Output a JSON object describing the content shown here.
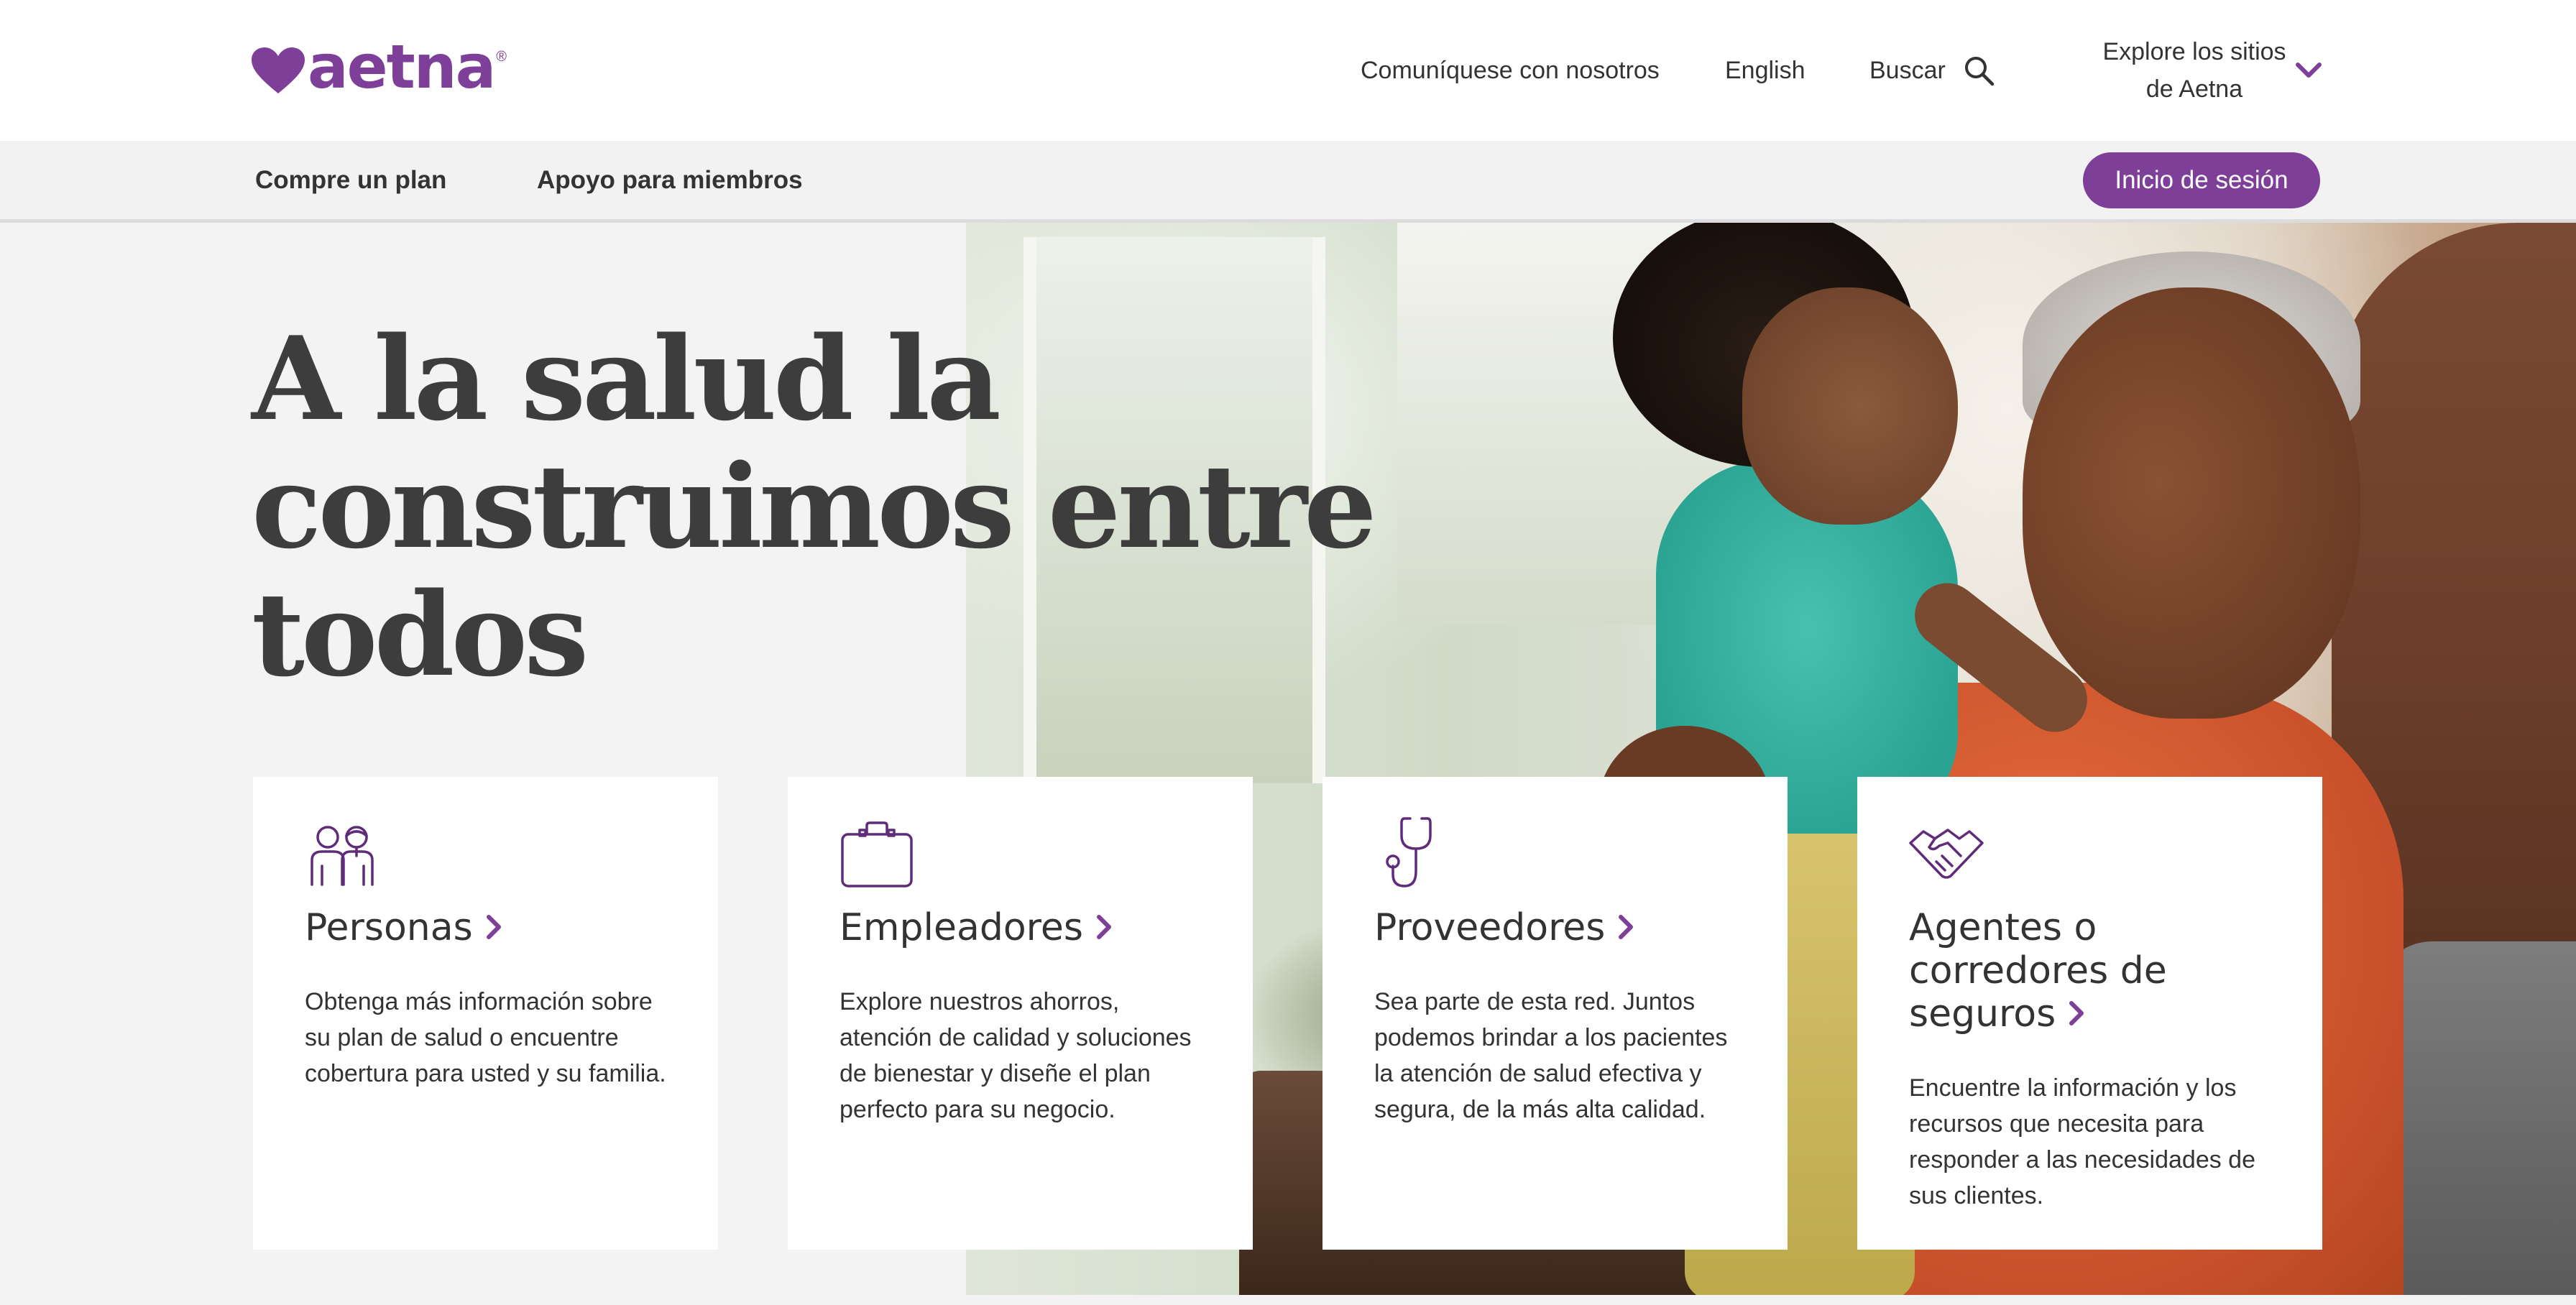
{
  "brand": {
    "name": "aetna",
    "reg": "®",
    "color": "#7d3f98"
  },
  "top_nav": {
    "contact": "Comuníquese con nosotros",
    "language": "English",
    "search": "Buscar",
    "explore": "Explore los sitios de Aetna"
  },
  "sub_nav": {
    "buy_plan": "Compre un plan",
    "member_support": "Apoyo para miembros",
    "login": "Inicio de sesión"
  },
  "hero": {
    "headline_lines": [
      "A la salud la",
      "construimos entre",
      "todos"
    ]
  },
  "cards": [
    {
      "icon": "people-icon",
      "title": "Personas",
      "body": "Obtenga más información sobre su plan de salud o encuentre cobertura para usted y su familia."
    },
    {
      "icon": "briefcase-icon",
      "title": "Empleadores",
      "body": "Explore nuestros ahorros, atención de calidad y soluciones de bienestar y diseñe el plan perfecto para su negocio."
    },
    {
      "icon": "stethoscope-icon",
      "title": "Proveedores",
      "body": "Sea parte de esta red. Juntos podemos brindar a los pacientes la atención de salud efectiva y segura, de la más alta calidad."
    },
    {
      "icon": "handshake-icon",
      "title_lines": [
        "Agentes o",
        "corredores de",
        "seguros"
      ],
      "body": "Encuentre la información y los recursos que necesita para responder a las necesidades de sus clientes."
    }
  ]
}
